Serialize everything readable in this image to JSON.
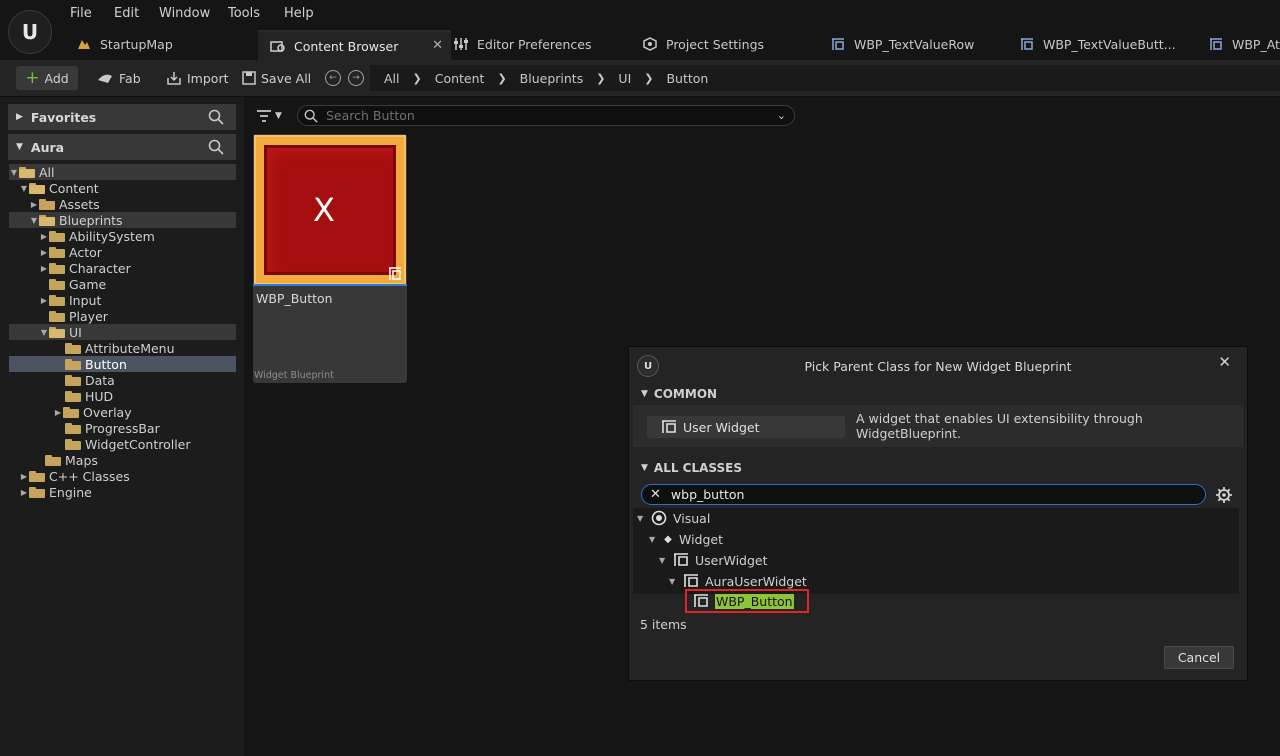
{
  "menu": [
    "File",
    "Edit",
    "Window",
    "Tools",
    "Help"
  ],
  "tabs": [
    {
      "label": "StartupMap",
      "icon": "map-icon"
    },
    {
      "label": "Content Browser",
      "icon": "content-browser-icon",
      "active": true
    },
    {
      "label": "Editor Preferences",
      "icon": "sliders-icon"
    },
    {
      "label": "Project Settings",
      "icon": "project-settings-icon"
    },
    {
      "label": "WBP_TextValueRow",
      "icon": "widget-icon"
    },
    {
      "label": "WBP_TextValueButt...",
      "icon": "widget-icon"
    },
    {
      "label": "WBP_Att",
      "icon": "widget-icon"
    }
  ],
  "toolbar": {
    "add_label": "Add",
    "fab_label": "Fab",
    "import_label": "Import",
    "save_all_label": "Save All"
  },
  "breadcrumb": [
    "All",
    "Content",
    "Blueprints",
    "UI",
    "Button"
  ],
  "favorites": {
    "label": "Favorites"
  },
  "project": {
    "label": "Aura"
  },
  "tree": [
    {
      "label": "All"
    },
    {
      "label": "Content"
    },
    {
      "label": "Assets"
    },
    {
      "label": "Blueprints"
    },
    {
      "label": "AbilitySystem"
    },
    {
      "label": "Actor"
    },
    {
      "label": "Character"
    },
    {
      "label": "Game"
    },
    {
      "label": "Input"
    },
    {
      "label": "Player"
    },
    {
      "label": "UI"
    },
    {
      "label": "AttributeMenu"
    },
    {
      "label": "Button"
    },
    {
      "label": "Data"
    },
    {
      "label": "HUD"
    },
    {
      "label": "Overlay"
    },
    {
      "label": "ProgressBar"
    },
    {
      "label": "WidgetController"
    },
    {
      "label": "Maps"
    },
    {
      "label": "C++ Classes"
    },
    {
      "label": "Engine"
    }
  ],
  "search": {
    "placeholder": "Search Button"
  },
  "asset": {
    "thumb_text": "X",
    "name": "WBP_Button",
    "type": "Widget Blueprint"
  },
  "dialog": {
    "title": "Pick Parent Class for New Widget Blueprint",
    "common_header": "COMMON",
    "user_widget_label": "User Widget",
    "user_widget_desc": "A widget that enables UI extensibility through WidgetBlueprint.",
    "all_classes_header": "ALL CLASSES",
    "class_search_value": "wbp_button",
    "class_tree": [
      {
        "label": "Visual"
      },
      {
        "label": "Widget"
      },
      {
        "label": "UserWidget"
      },
      {
        "label": "AuraUserWidget"
      },
      {
        "label": "WBP_Button"
      }
    ],
    "item_count": "5 items",
    "cancel_label": "Cancel"
  },
  "colors": {
    "accent": "#2a7fd6",
    "highlight": "#8ec43c",
    "selection_box": "#e0242a",
    "folder": "#c6a45e",
    "thumb_border": "#f3a93d",
    "thumb_fill": "#a60f0f"
  }
}
